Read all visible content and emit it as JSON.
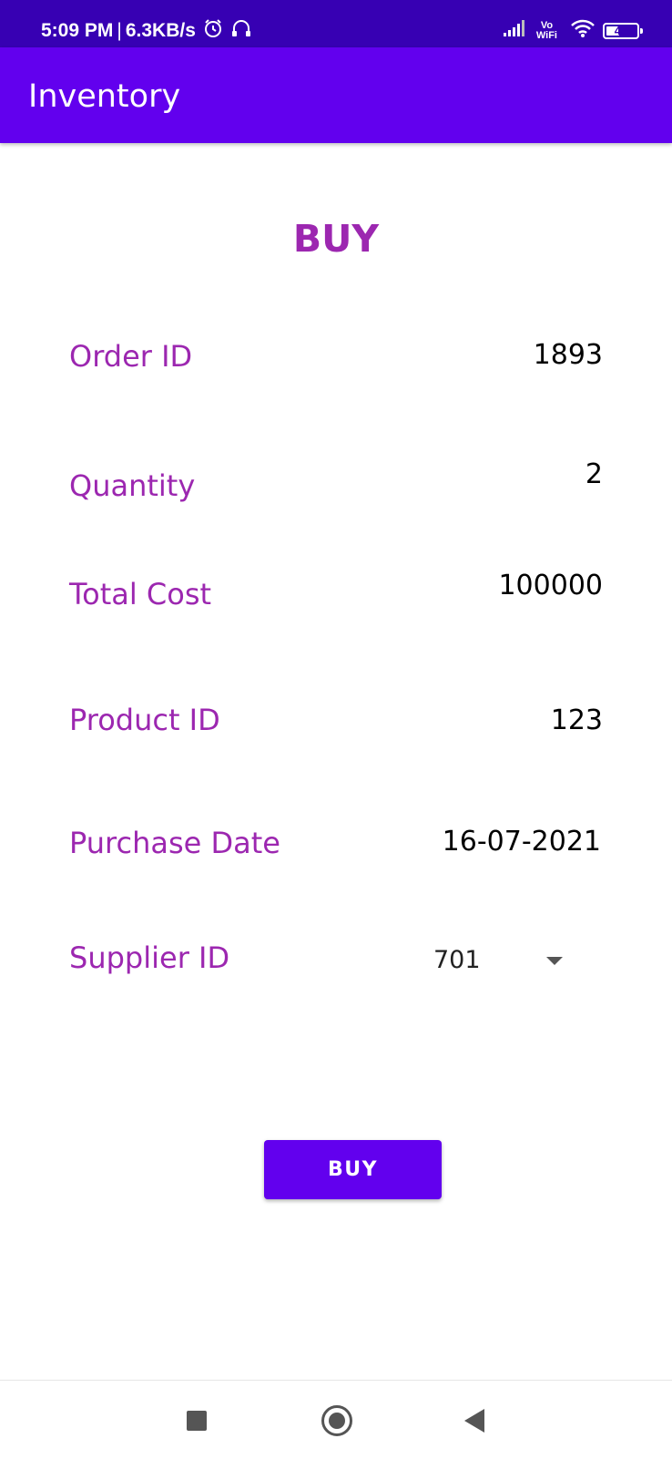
{
  "status_bar": {
    "time": "5:09 PM",
    "separator": "|",
    "net_speed": "6.3KB/s",
    "vowifi_top": "Vo",
    "vowifi_bottom": "WiFi",
    "battery": "44",
    "battery_level": 0.44,
    "icons": [
      "alarm-icon",
      "headset-icon",
      "signal-icon",
      "wifi-icon",
      "battery-icon"
    ]
  },
  "app_bar": {
    "title": "Inventory"
  },
  "form": {
    "heading": "BUY",
    "fields": [
      {
        "label": "Order ID",
        "value": "1893"
      },
      {
        "label": "Quantity",
        "value": "2"
      },
      {
        "label": "Total Cost",
        "value": "100000"
      },
      {
        "label": "Product ID",
        "value": "123"
      },
      {
        "label": "Purchase Date",
        "value": "16-07-2021"
      }
    ],
    "supplier": {
      "label": "Supplier ID",
      "selected": "701"
    },
    "buy_button": "BUY"
  },
  "nav_bar": {
    "icons": [
      "recents-icon",
      "home-icon",
      "back-icon"
    ]
  },
  "colors": {
    "status_bar": "#3700b3",
    "primary": "#6200ee",
    "accent_text": "#9c27b0"
  }
}
